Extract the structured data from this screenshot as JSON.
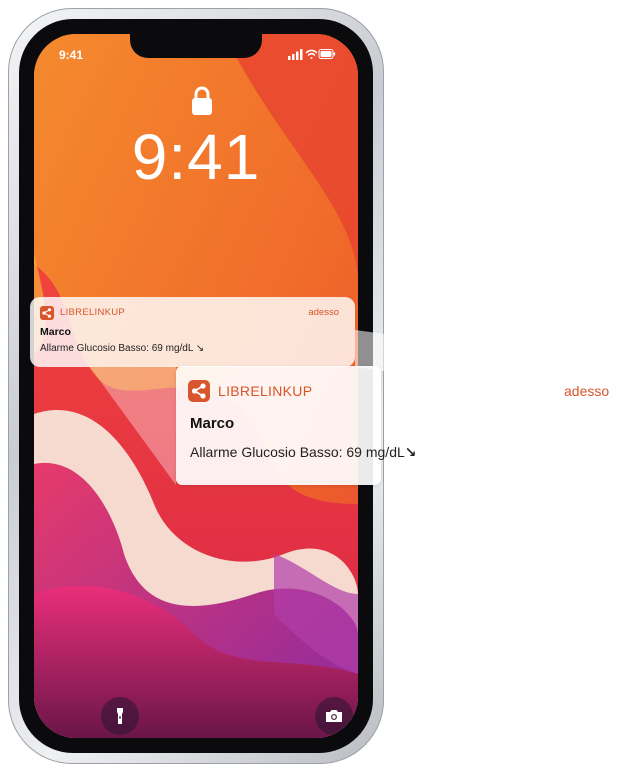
{
  "status_bar": {
    "time": "9:41"
  },
  "lock_screen": {
    "time": "9:41"
  },
  "notification": {
    "app_name": "LIBRELINKUP",
    "timestamp": "adesso",
    "title": "Marco",
    "message_prefix": "Allarme Glucosio Basso: 69 mg/dL",
    "trend_arrow": "↘",
    "message_small": "Allarme Glucosio Basso: 69 mg/dL ↘"
  },
  "icons": {
    "status": [
      "cellular-signal-icon",
      "wifi-icon",
      "battery-icon"
    ],
    "lock": "lock-icon",
    "app": "share-icon",
    "quick_actions": [
      "flashlight-icon",
      "camera-icon"
    ]
  },
  "colors": {
    "accent": "#d9552c",
    "wallpaper_orange": "#f07a2a",
    "wallpaper_red": "#e1403a",
    "wallpaper_purple": "#5a1a5a"
  }
}
